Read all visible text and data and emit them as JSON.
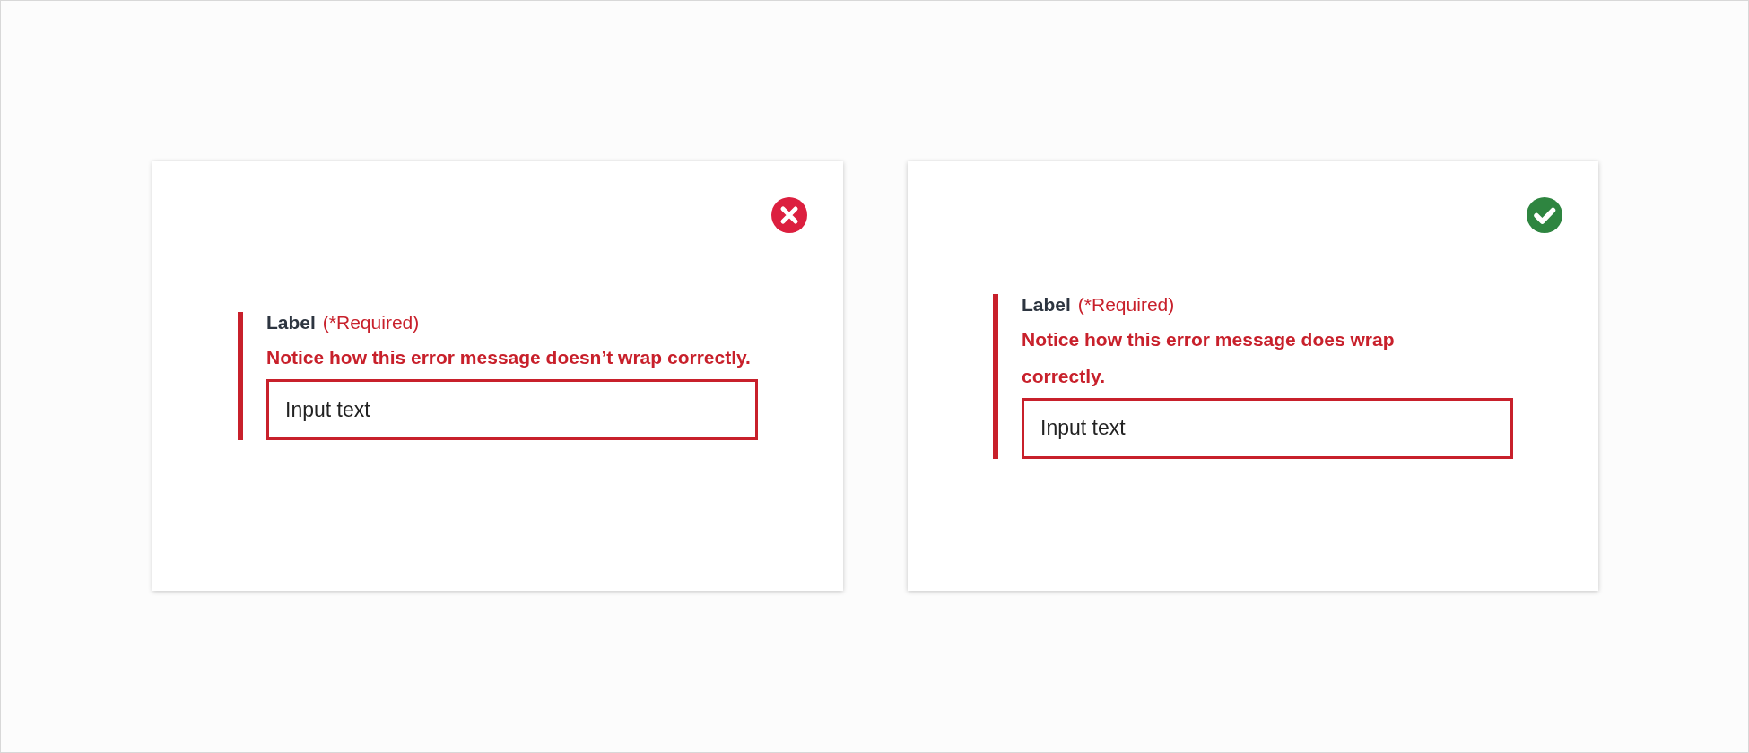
{
  "examples": [
    {
      "kind": "incorrect",
      "label": "Label",
      "required": "(*Required)",
      "error": "Notice how this error message doesn’t wrap correctly.",
      "wraps": false,
      "value": "Input text"
    },
    {
      "kind": "correct",
      "label": "Label",
      "required": "(*Required)",
      "error": "Notice how this error message does wrap correctly.",
      "wraps": true,
      "value": "Input text"
    }
  ]
}
